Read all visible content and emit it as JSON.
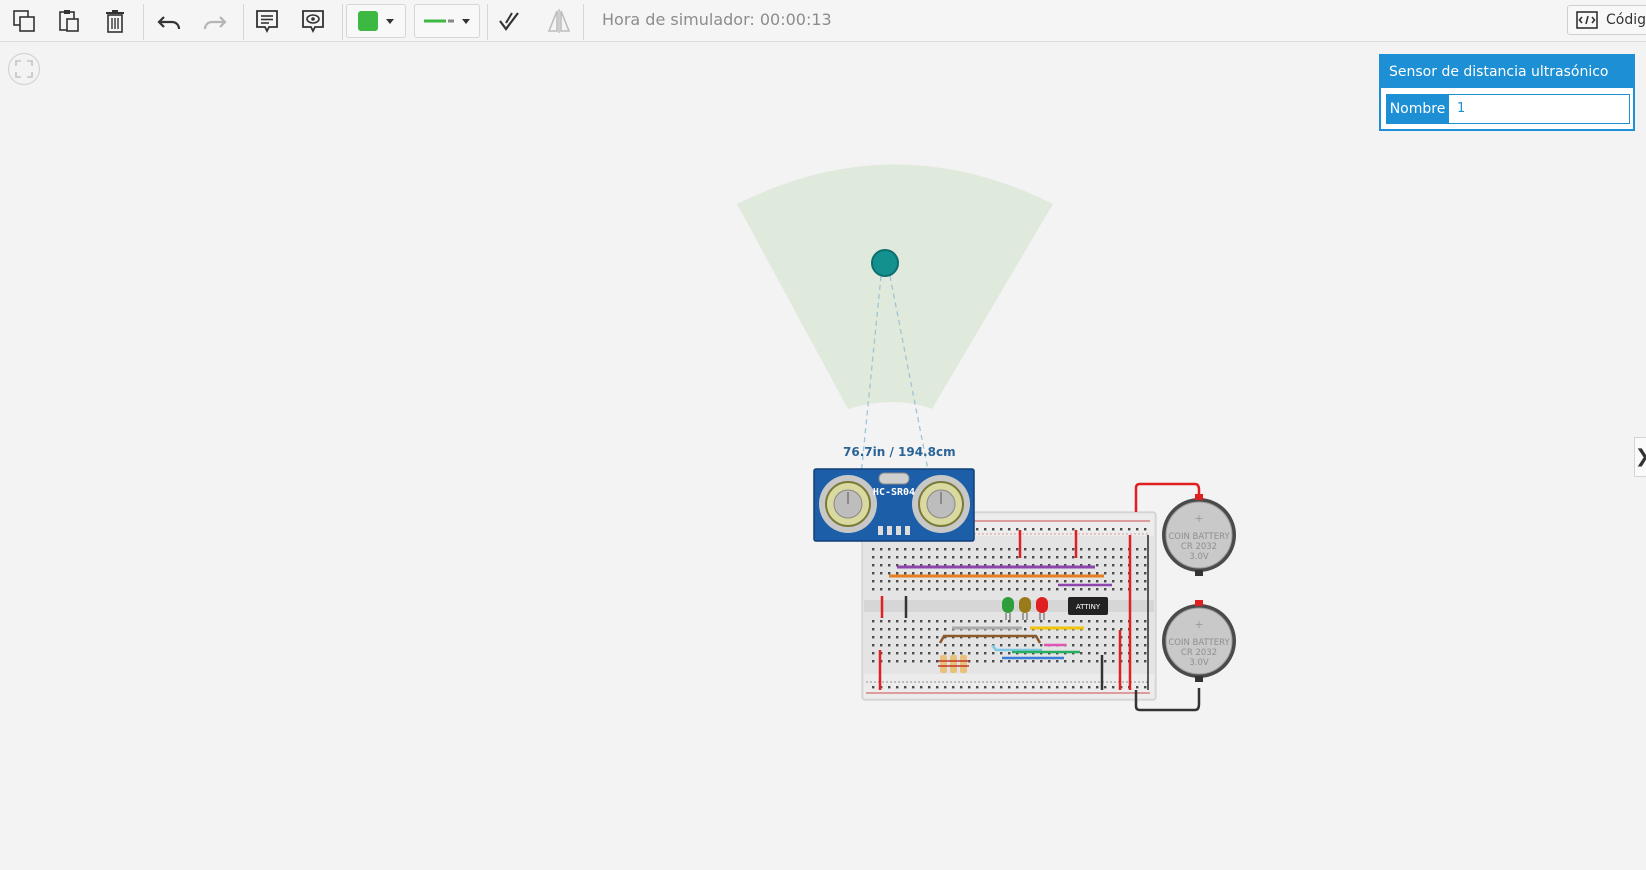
{
  "toolbar": {
    "sim_time": "Hora de simulador: 00:00:13",
    "code_label": "Código",
    "color_value": "#3db843",
    "wire_color": "#3db843"
  },
  "canvas": {
    "distance_label": "76.7in / 194.8cm",
    "sensor_model": "HC-SR04",
    "chip_label": "ATTINY",
    "battery_lines": [
      "COIN BATTERY",
      "CR 2032",
      "3.0V"
    ]
  },
  "inspector": {
    "title": "Sensor de distancia ultrasónico",
    "name_label": "Nombre",
    "name_value": "1"
  },
  "panel_toggle": "❯"
}
